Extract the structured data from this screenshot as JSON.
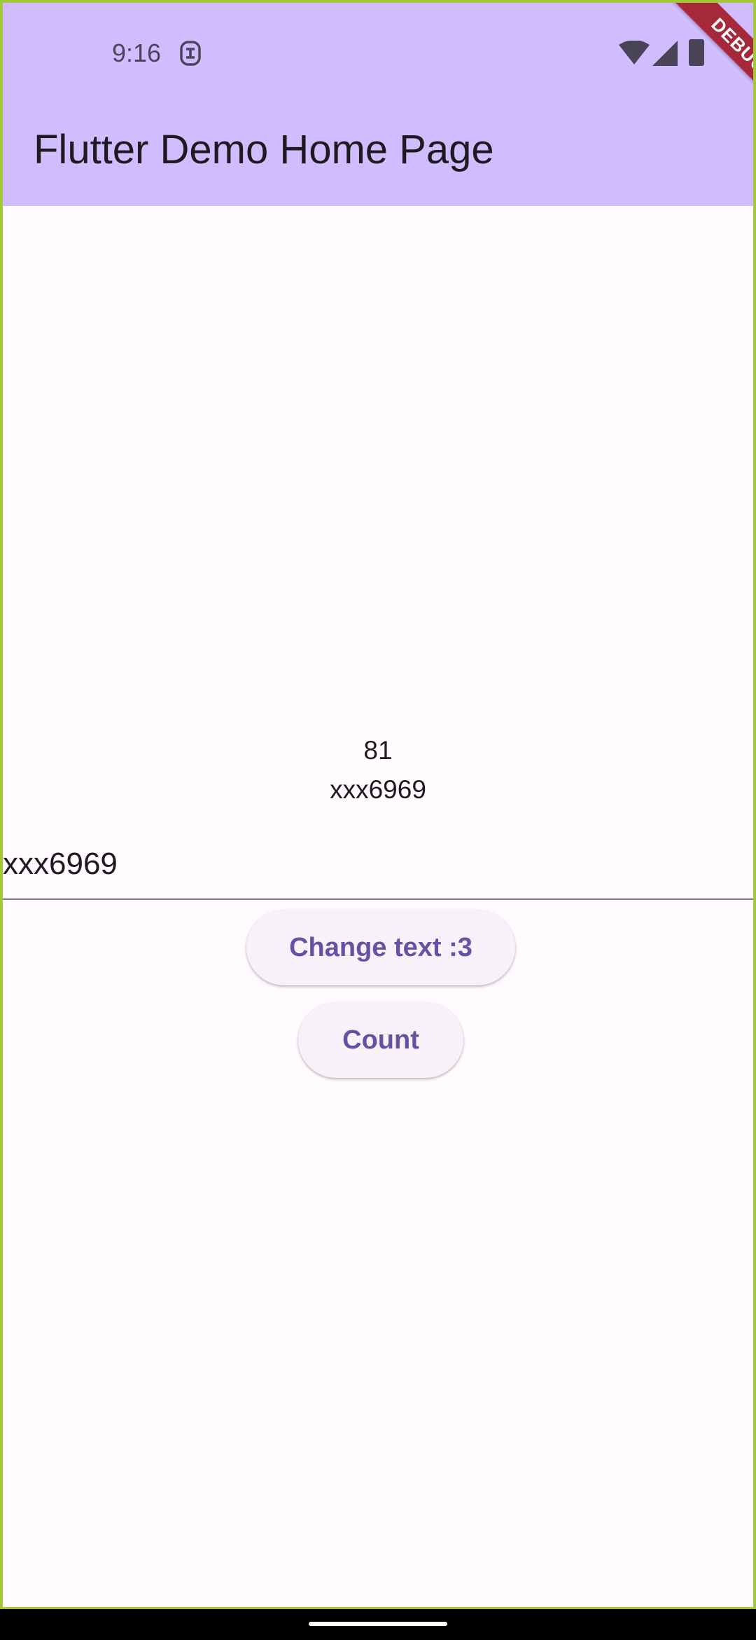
{
  "status_bar": {
    "time": "9:16",
    "icons": [
      "notification-icon",
      "wifi-icon",
      "signal-icon",
      "battery-icon"
    ]
  },
  "app_bar": {
    "title": "Flutter Demo Home Page",
    "color": "#d1bcff"
  },
  "debug_banner": {
    "label": "DEBUG",
    "color": "#a6283b"
  },
  "body": {
    "counter": "81",
    "label": "xxx6969",
    "text_field_value": "xxx6969",
    "change_text_button": "Change text :3",
    "count_button": "Count"
  },
  "colors": {
    "accent": "#6750a4",
    "button_bg": "#f7f2fa",
    "background": "#fffbfe",
    "frame_border": "#a4c639"
  }
}
